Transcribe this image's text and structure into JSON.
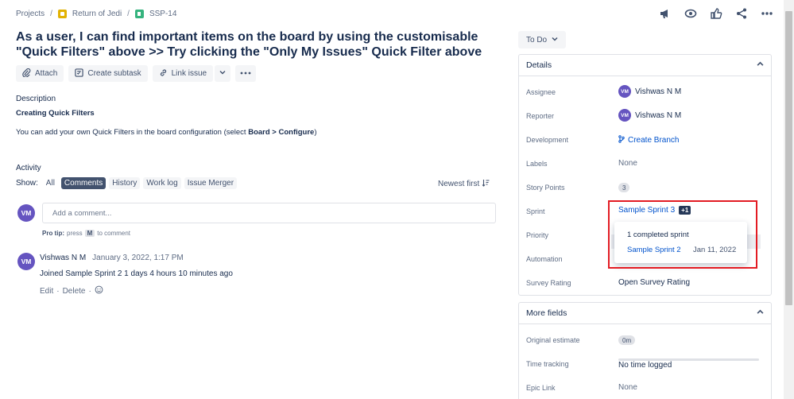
{
  "breadcrumb": {
    "projects": "Projects",
    "project": "Return of Jedi",
    "issue_key": "SSP-14"
  },
  "issue": {
    "title": "As a user, I can find important items on the board by using the customisable \"Quick Filters\" above >> Try clicking the \"Only My Issues\" Quick Filter above"
  },
  "toolbar": {
    "attach": "Attach",
    "create_subtask": "Create subtask",
    "link_issue": "Link issue"
  },
  "description": {
    "label": "Description",
    "heading": "Creating Quick Filters",
    "text_prefix": "You can add your own Quick Filters in the board configuration (select ",
    "board": "Board",
    "arrow": " > ",
    "configure": "Configure",
    "text_suffix": ")"
  },
  "activity": {
    "label": "Activity",
    "show": "Show:",
    "tabs": [
      "All",
      "Comments",
      "History",
      "Work log",
      "Issue Merger"
    ],
    "sort": "Newest first"
  },
  "comment": {
    "avatar": "VM",
    "placeholder": "Add a comment...",
    "protip_label": "Pro tip:",
    "protip_press": "press",
    "protip_key": "M",
    "protip_suffix": "to comment"
  },
  "entry": {
    "avatar": "VM",
    "author": "Vishwas N M",
    "time": "January 3, 2022, 1:17 PM",
    "body": "Joined Sample Sprint 2 1 days 4 hours 10 minutes ago",
    "edit": "Edit",
    "delete": "Delete",
    "dot": "·"
  },
  "status": {
    "label": "To Do"
  },
  "details": {
    "title": "Details",
    "assignee_label": "Assignee",
    "assignee": "Vishwas N M",
    "assignee_avatar": "VM",
    "reporter_label": "Reporter",
    "reporter": "Vishwas N M",
    "reporter_avatar": "VM",
    "development_label": "Development",
    "development": "Create Branch",
    "labels_label": "Labels",
    "labels": "None",
    "story_points_label": "Story Points",
    "story_points": "3",
    "sprint_label": "Sprint",
    "sprint": "Sample Sprint 3",
    "sprint_extra": "+1",
    "priority_label": "Priority",
    "automation_label": "Automation",
    "survey_label": "Survey Rating",
    "survey": "Open Survey Rating"
  },
  "sprint_popup": {
    "title": "1 completed sprint",
    "sprint": "Sample Sprint 2",
    "date": "Jan 11, 2022"
  },
  "more_fields": {
    "title": "More fields",
    "original_estimate_label": "Original estimate",
    "original_estimate": "0m",
    "time_tracking_label": "Time tracking",
    "time_tracking": "No time logged",
    "epic_link_label": "Epic Link",
    "epic_link": "None"
  }
}
